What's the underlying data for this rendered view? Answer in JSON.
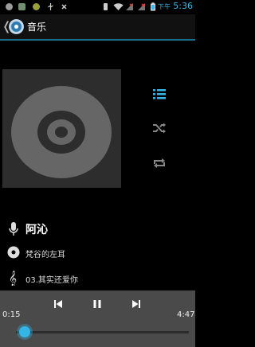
{
  "status_bar": {
    "ampm": "下午",
    "time": "5:36"
  },
  "action_bar": {
    "title": "音乐"
  },
  "track": {
    "artist": "阿沁",
    "album": "梵谷的左耳",
    "song": "03.其实还爱你"
  },
  "playback": {
    "current_time": "0:15",
    "total_time": "4:47",
    "progress": 0.05
  },
  "colors": {
    "accent": "#33b5e5",
    "control_bar": "#4a4a4a",
    "album_bg": "#2d2d2d"
  }
}
